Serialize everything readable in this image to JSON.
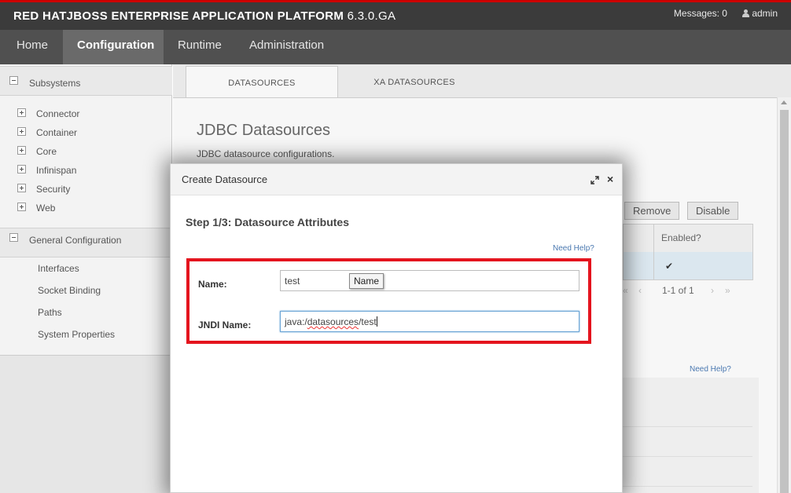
{
  "brand": {
    "part1": "RED HAT",
    "part2": "JBOSS",
    "part3": " ENTERPRISE APPLICATION PLATFORM",
    "version": "6.3.0.GA"
  },
  "topright": {
    "messages": "Messages: 0",
    "user": "admin"
  },
  "nav": {
    "items": [
      "Home",
      "Configuration",
      "Runtime",
      "Administration"
    ],
    "active": "Configuration"
  },
  "sidebar": {
    "group1": "Subsystems",
    "subsystems": [
      "Connector",
      "Container",
      "Core",
      "Infinispan",
      "Security",
      "Web"
    ],
    "group2": "General Configuration",
    "general": [
      "Interfaces",
      "Socket Binding",
      "Paths",
      "System Properties"
    ]
  },
  "tabs": [
    "DATASOURCES",
    "XA DATASOURCES"
  ],
  "page": {
    "title": "JDBC Datasources",
    "description": "JDBC datasource configurations."
  },
  "toolbar": {
    "remove": "Remove",
    "disable": "Disable"
  },
  "table": {
    "col_enabled": "Enabled?",
    "pager": "1-1 of 1"
  },
  "help_link_2": "Need Help?",
  "modal": {
    "title": "Create Datasource",
    "step": "Step 1/3: Datasource Attributes",
    "help": "Need Help?",
    "name_label": "Name:",
    "name_value": "test",
    "jndi_label": "JNDI Name:",
    "jndi_prefix": "java:/",
    "jndi_mid": "datasources",
    "jndi_suffix": "/test",
    "tooltip": "Name"
  },
  "colors": {
    "accent_red": "#e4141e",
    "brand_red": "#cc0000",
    "link": "#4a78b0"
  }
}
